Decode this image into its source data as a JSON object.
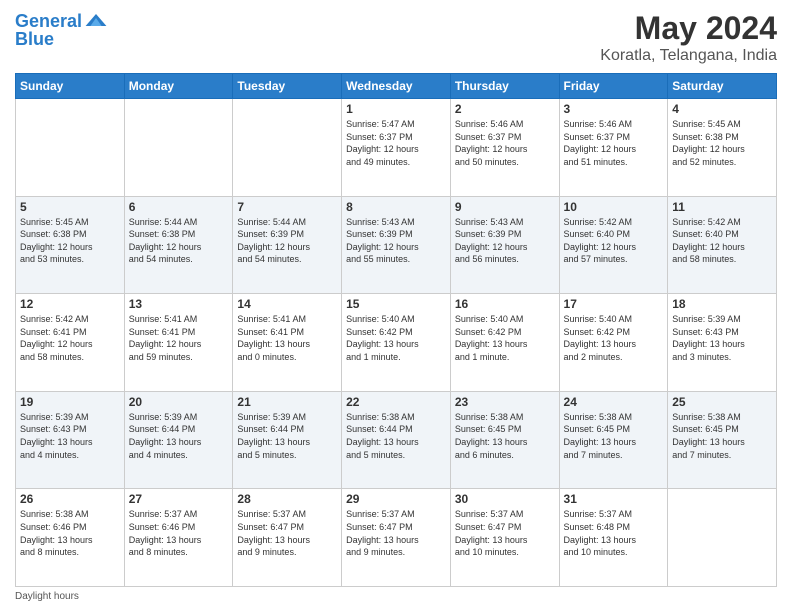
{
  "header": {
    "logo_line1": "General",
    "logo_line2": "Blue",
    "title": "May 2024",
    "subtitle": "Koratla, Telangana, India"
  },
  "weekdays": [
    "Sunday",
    "Monday",
    "Tuesday",
    "Wednesday",
    "Thursday",
    "Friday",
    "Saturday"
  ],
  "weeks": [
    [
      {
        "day": "",
        "info": ""
      },
      {
        "day": "",
        "info": ""
      },
      {
        "day": "",
        "info": ""
      },
      {
        "day": "1",
        "info": "Sunrise: 5:47 AM\nSunset: 6:37 PM\nDaylight: 12 hours\nand 49 minutes."
      },
      {
        "day": "2",
        "info": "Sunrise: 5:46 AM\nSunset: 6:37 PM\nDaylight: 12 hours\nand 50 minutes."
      },
      {
        "day": "3",
        "info": "Sunrise: 5:46 AM\nSunset: 6:37 PM\nDaylight: 12 hours\nand 51 minutes."
      },
      {
        "day": "4",
        "info": "Sunrise: 5:45 AM\nSunset: 6:38 PM\nDaylight: 12 hours\nand 52 minutes."
      }
    ],
    [
      {
        "day": "5",
        "info": "Sunrise: 5:45 AM\nSunset: 6:38 PM\nDaylight: 12 hours\nand 53 minutes."
      },
      {
        "day": "6",
        "info": "Sunrise: 5:44 AM\nSunset: 6:38 PM\nDaylight: 12 hours\nand 54 minutes."
      },
      {
        "day": "7",
        "info": "Sunrise: 5:44 AM\nSunset: 6:39 PM\nDaylight: 12 hours\nand 54 minutes."
      },
      {
        "day": "8",
        "info": "Sunrise: 5:43 AM\nSunset: 6:39 PM\nDaylight: 12 hours\nand 55 minutes."
      },
      {
        "day": "9",
        "info": "Sunrise: 5:43 AM\nSunset: 6:39 PM\nDaylight: 12 hours\nand 56 minutes."
      },
      {
        "day": "10",
        "info": "Sunrise: 5:42 AM\nSunset: 6:40 PM\nDaylight: 12 hours\nand 57 minutes."
      },
      {
        "day": "11",
        "info": "Sunrise: 5:42 AM\nSunset: 6:40 PM\nDaylight: 12 hours\nand 58 minutes."
      }
    ],
    [
      {
        "day": "12",
        "info": "Sunrise: 5:42 AM\nSunset: 6:41 PM\nDaylight: 12 hours\nand 58 minutes."
      },
      {
        "day": "13",
        "info": "Sunrise: 5:41 AM\nSunset: 6:41 PM\nDaylight: 12 hours\nand 59 minutes."
      },
      {
        "day": "14",
        "info": "Sunrise: 5:41 AM\nSunset: 6:41 PM\nDaylight: 13 hours\nand 0 minutes."
      },
      {
        "day": "15",
        "info": "Sunrise: 5:40 AM\nSunset: 6:42 PM\nDaylight: 13 hours\nand 1 minute."
      },
      {
        "day": "16",
        "info": "Sunrise: 5:40 AM\nSunset: 6:42 PM\nDaylight: 13 hours\nand 1 minute."
      },
      {
        "day": "17",
        "info": "Sunrise: 5:40 AM\nSunset: 6:42 PM\nDaylight: 13 hours\nand 2 minutes."
      },
      {
        "day": "18",
        "info": "Sunrise: 5:39 AM\nSunset: 6:43 PM\nDaylight: 13 hours\nand 3 minutes."
      }
    ],
    [
      {
        "day": "19",
        "info": "Sunrise: 5:39 AM\nSunset: 6:43 PM\nDaylight: 13 hours\nand 4 minutes."
      },
      {
        "day": "20",
        "info": "Sunrise: 5:39 AM\nSunset: 6:44 PM\nDaylight: 13 hours\nand 4 minutes."
      },
      {
        "day": "21",
        "info": "Sunrise: 5:39 AM\nSunset: 6:44 PM\nDaylight: 13 hours\nand 5 minutes."
      },
      {
        "day": "22",
        "info": "Sunrise: 5:38 AM\nSunset: 6:44 PM\nDaylight: 13 hours\nand 5 minutes."
      },
      {
        "day": "23",
        "info": "Sunrise: 5:38 AM\nSunset: 6:45 PM\nDaylight: 13 hours\nand 6 minutes."
      },
      {
        "day": "24",
        "info": "Sunrise: 5:38 AM\nSunset: 6:45 PM\nDaylight: 13 hours\nand 7 minutes."
      },
      {
        "day": "25",
        "info": "Sunrise: 5:38 AM\nSunset: 6:45 PM\nDaylight: 13 hours\nand 7 minutes."
      }
    ],
    [
      {
        "day": "26",
        "info": "Sunrise: 5:38 AM\nSunset: 6:46 PM\nDaylight: 13 hours\nand 8 minutes."
      },
      {
        "day": "27",
        "info": "Sunrise: 5:37 AM\nSunset: 6:46 PM\nDaylight: 13 hours\nand 8 minutes."
      },
      {
        "day": "28",
        "info": "Sunrise: 5:37 AM\nSunset: 6:47 PM\nDaylight: 13 hours\nand 9 minutes."
      },
      {
        "day": "29",
        "info": "Sunrise: 5:37 AM\nSunset: 6:47 PM\nDaylight: 13 hours\nand 9 minutes."
      },
      {
        "day": "30",
        "info": "Sunrise: 5:37 AM\nSunset: 6:47 PM\nDaylight: 13 hours\nand 10 minutes."
      },
      {
        "day": "31",
        "info": "Sunrise: 5:37 AM\nSunset: 6:48 PM\nDaylight: 13 hours\nand 10 minutes."
      },
      {
        "day": "",
        "info": ""
      }
    ]
  ],
  "footer": "Daylight hours"
}
